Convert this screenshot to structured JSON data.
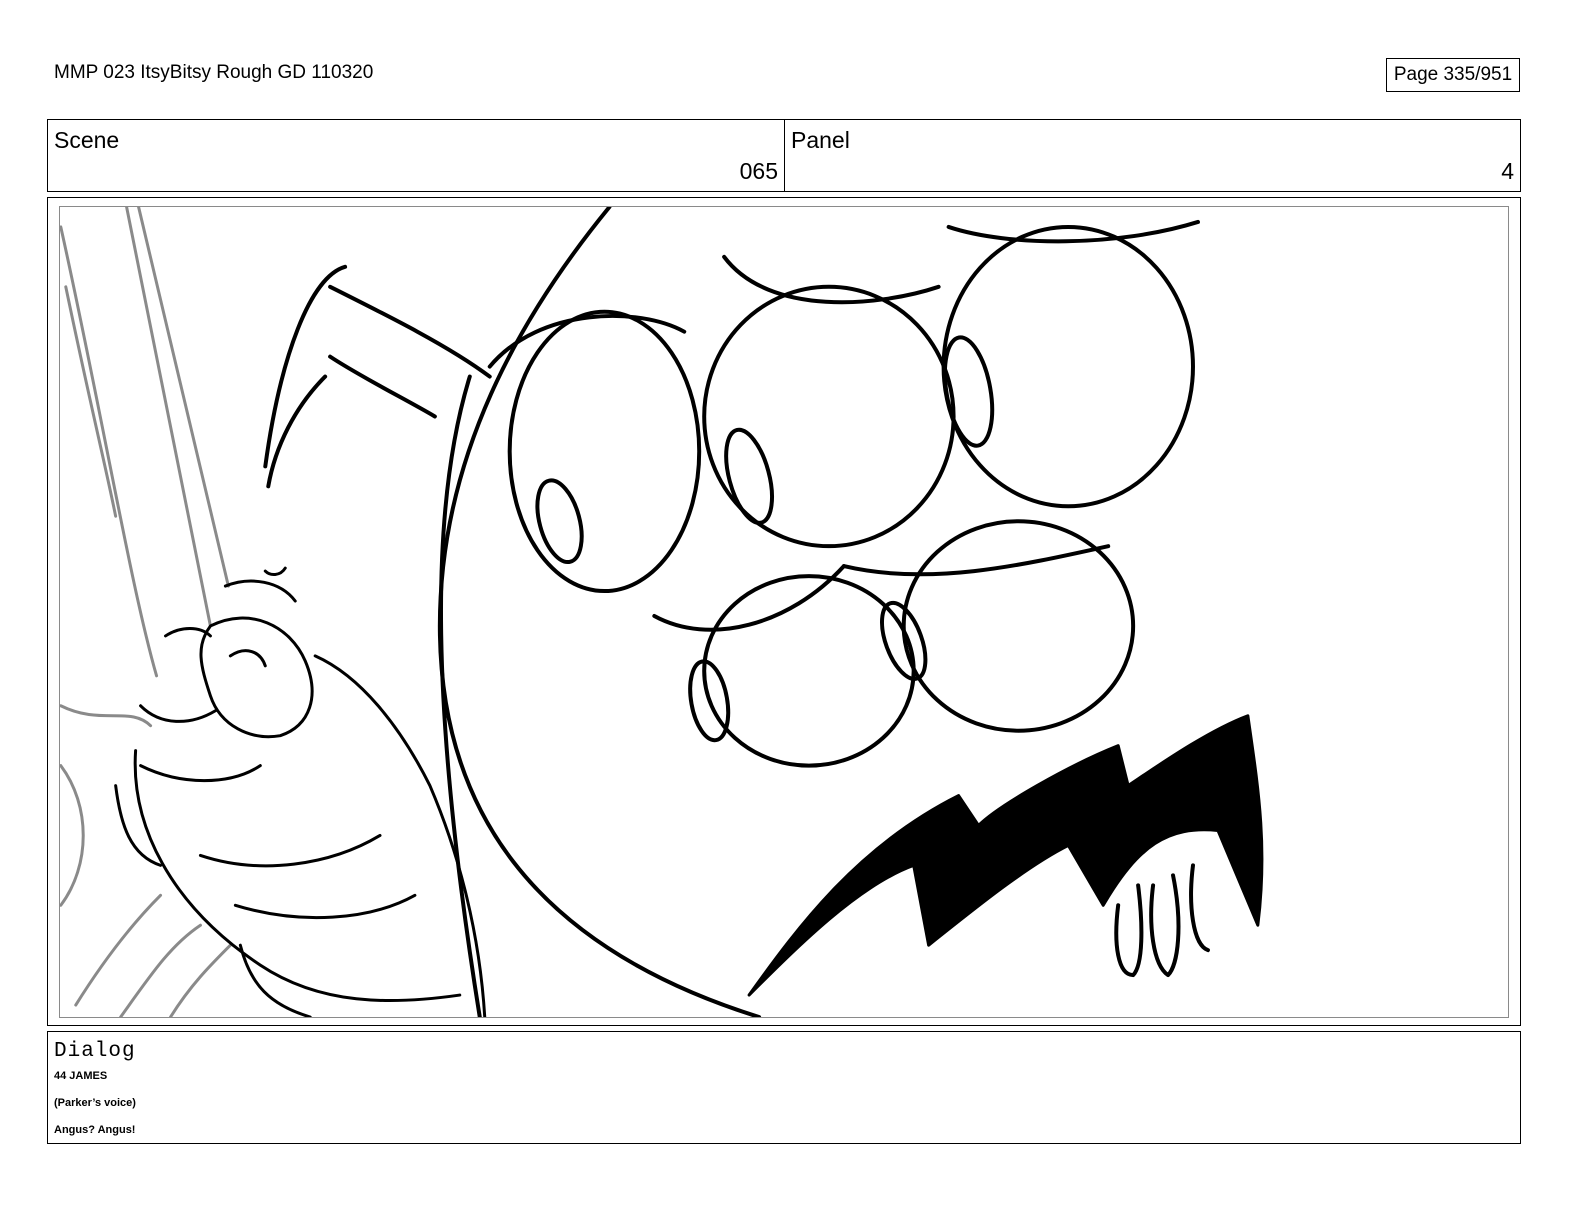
{
  "document": {
    "title": "MMP 023 ItsyBitsy Rough GD 110320",
    "page": "Page 335/951"
  },
  "header": {
    "scene_label": "Scene",
    "scene_value": "065",
    "panel_label": "Panel",
    "panel_value": "4"
  },
  "dialog": {
    "label": "Dialog",
    "lines": [
      "44 JAMES",
      "(Parker’s voice)",
      "Angus? Angus!"
    ]
  }
}
